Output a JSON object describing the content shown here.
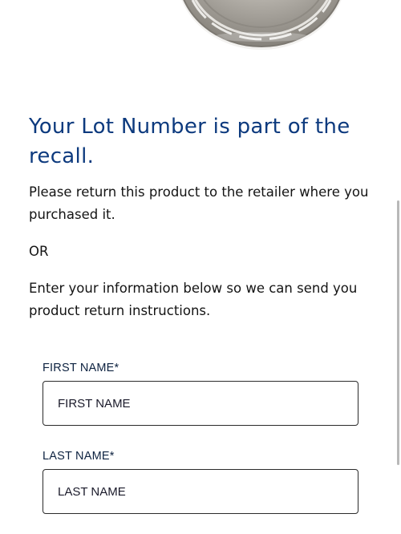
{
  "content": {
    "heading": "Your Lot Number is part of the recall.",
    "paragraph1": "Please return this product to the retailer where you purchased it.",
    "or_text": "OR",
    "paragraph2": "Enter your information below so we can send you product return instructions."
  },
  "form": {
    "first_name": {
      "label": "FIRST NAME*",
      "placeholder": "FIRST NAME",
      "value": ""
    },
    "last_name": {
      "label": "LAST NAME*",
      "placeholder": "LAST NAME",
      "value": ""
    }
  },
  "colors": {
    "heading": "#0d3a7e",
    "text": "#141414",
    "label": "#0d2240",
    "lid_label": "#d32a2a",
    "lid_metal": "#a29e97"
  },
  "icons": {
    "product_image": "product-lid-image"
  }
}
